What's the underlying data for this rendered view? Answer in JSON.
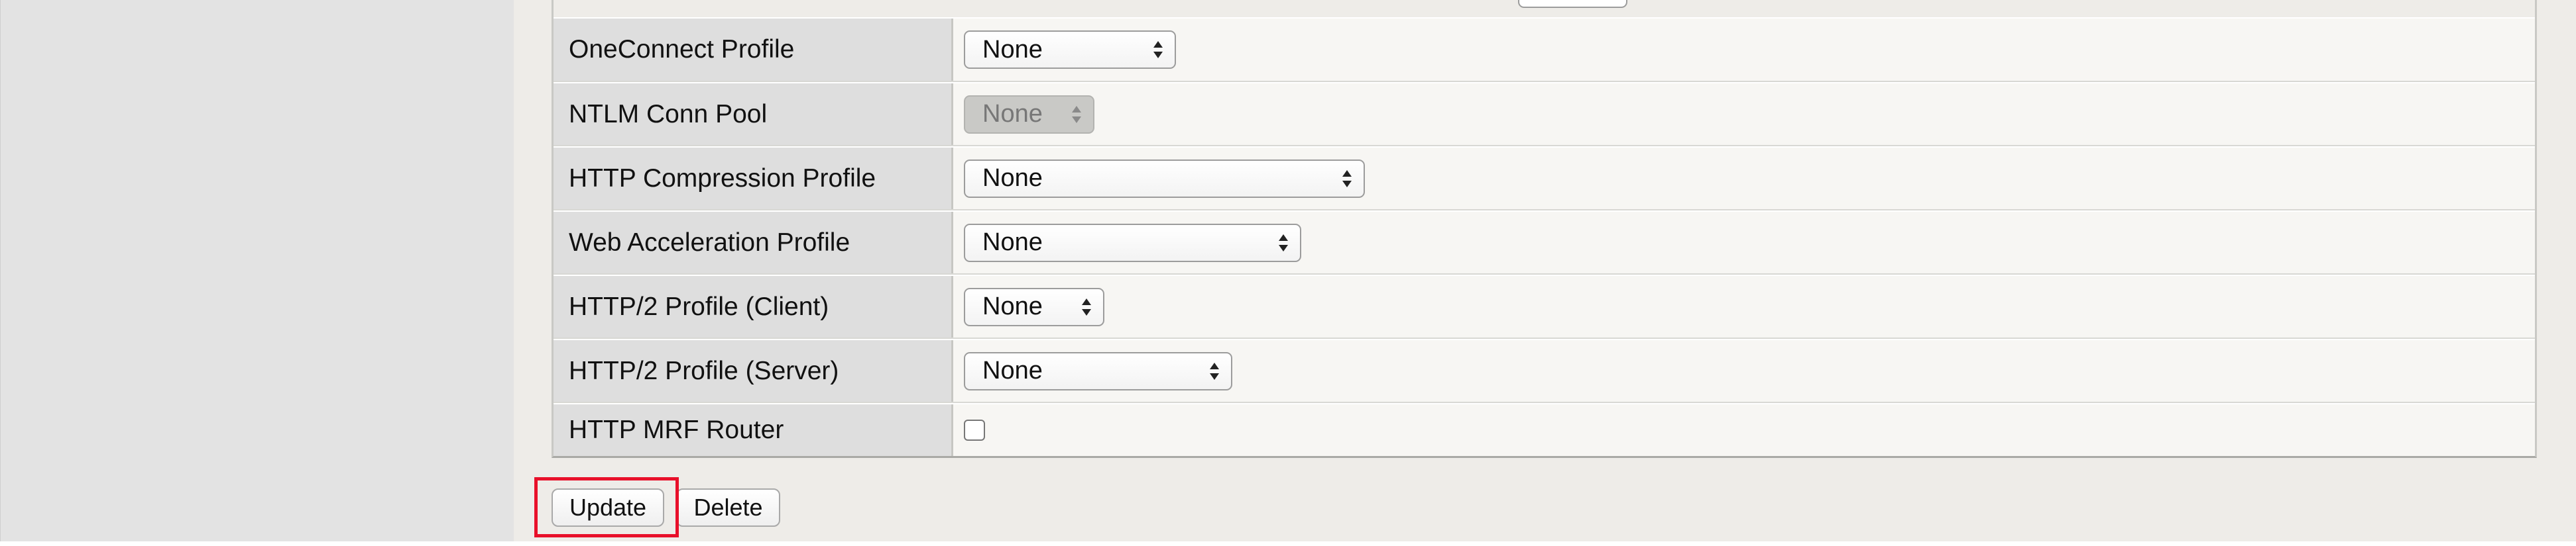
{
  "profiles_table": {
    "rows": [
      {
        "label": "OneConnect Profile",
        "control": "select",
        "value": "None"
      },
      {
        "label": "NTLM Conn Pool",
        "control": "select-disabled",
        "value": "None"
      },
      {
        "label": "HTTP Compression Profile",
        "control": "select",
        "value": "None"
      },
      {
        "label": "Web Acceleration Profile",
        "control": "select",
        "value": "None"
      },
      {
        "label": "HTTP/2 Profile (Client)",
        "control": "select",
        "value": "None"
      },
      {
        "label": "HTTP/2 Profile (Server)",
        "control": "select",
        "value": "None"
      },
      {
        "label": "HTTP MRF Router",
        "control": "checkbox",
        "checked": false
      }
    ]
  },
  "actions": {
    "update_label": "Update",
    "delete_label": "Delete"
  },
  "highlight_color": "#e8102a"
}
